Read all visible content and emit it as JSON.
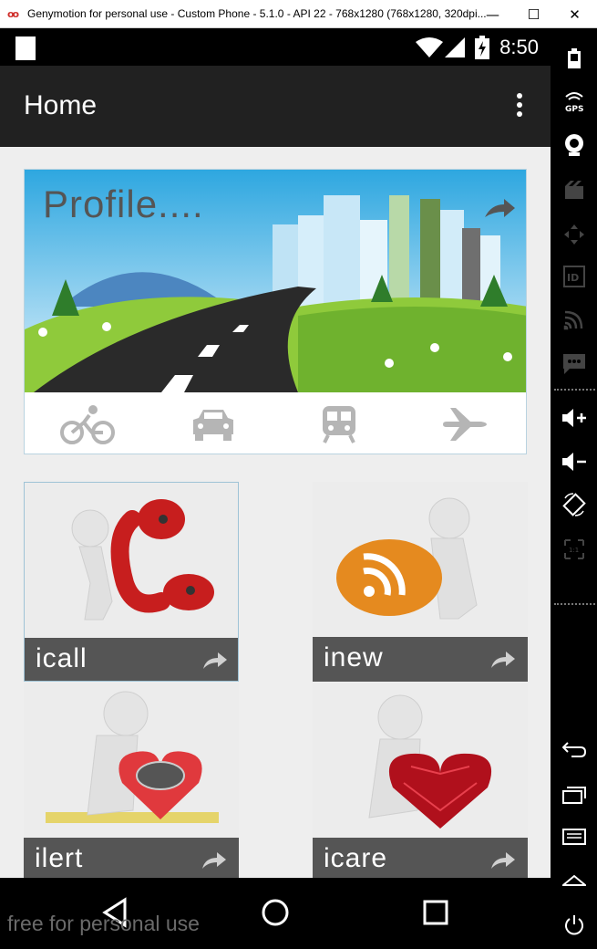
{
  "window": {
    "title": "Genymotion for personal use - Custom Phone - 5.1.0 - API 22 - 768x1280 (768x1280, 320dpi...",
    "logo": "oo",
    "minimize": "—",
    "maximize": "☐",
    "close": "✕"
  },
  "status_bar": {
    "time": "8:50"
  },
  "app_bar": {
    "title": "Home"
  },
  "banner": {
    "title": "Profile....",
    "transport_icons": [
      "bicycle-icon",
      "car-icon",
      "train-icon",
      "airplane-icon"
    ]
  },
  "tiles": [
    {
      "label": "icall"
    },
    {
      "label": "inew"
    },
    {
      "label": "ilert"
    },
    {
      "label": "icare"
    }
  ],
  "watermark": "free for personal use",
  "sidebar_tools": [
    "battery",
    "gps",
    "camera",
    "capture",
    "dpad",
    "id",
    "cast",
    "sms",
    "volume-up",
    "volume-down",
    "rotate",
    "scale",
    "back",
    "recent",
    "menu",
    "home",
    "power"
  ]
}
